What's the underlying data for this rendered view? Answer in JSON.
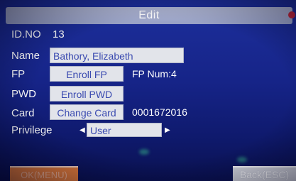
{
  "window": {
    "title": "Edit"
  },
  "form": {
    "id": {
      "label": "ID.NO",
      "value": "13"
    },
    "name": {
      "label": "Name",
      "value": "Bathory, Elizabeth"
    },
    "fp": {
      "label": "FP",
      "button": "Enroll FP",
      "status": "FP Num:4"
    },
    "pwd": {
      "label": "PWD",
      "button": "Enroll PWD"
    },
    "card": {
      "label": "Card",
      "button": "Change Card",
      "number": "0001672016"
    },
    "privilege": {
      "label": "Privilege",
      "value": "User"
    }
  },
  "footer": {
    "ok_label": "OK(MENU)",
    "back_label": "Back(ESC)"
  },
  "colors": {
    "background": "#1a2a8f",
    "field": "#e2e4ea",
    "field_text": "#3a4ab0",
    "ok_button": "#e07a3a",
    "close_dot": "#c2283a"
  }
}
